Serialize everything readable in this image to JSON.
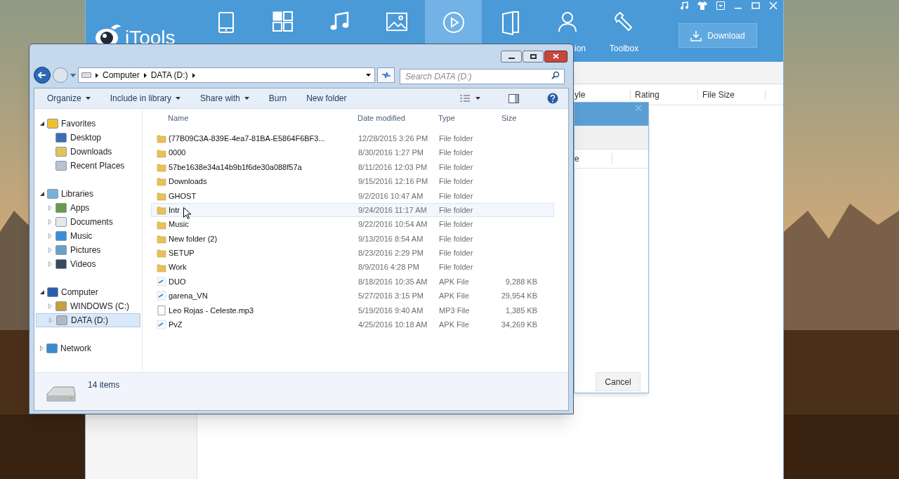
{
  "itools": {
    "logo": "iTools",
    "nav": [
      {
        "selected": false
      },
      {
        "selected": false
      },
      {
        "selected": false
      },
      {
        "selected": false
      },
      {
        "selected": true
      },
      {
        "selected": false
      },
      {
        "selected": false,
        "label": "ion"
      },
      {
        "selected": false,
        "label": "Toolbox"
      }
    ],
    "download_button": "Download",
    "columns": [
      "yle",
      "Rating",
      "File Size"
    ],
    "dialog": {
      "column": "e",
      "cancel": "Cancel"
    }
  },
  "explorer": {
    "breadcrumbs": [
      "Computer",
      "DATA (D:)"
    ],
    "search": {
      "placeholder": "Search DATA (D:)"
    },
    "toolbar": [
      {
        "label": "Organize",
        "dropdown": true
      },
      {
        "label": "Include in library",
        "dropdown": true
      },
      {
        "label": "Share with",
        "dropdown": true
      },
      {
        "label": "Burn",
        "dropdown": false
      },
      {
        "label": "New folder",
        "dropdown": false
      }
    ],
    "nav": [
      {
        "label": "Favorites",
        "expanded": true,
        "selected": false,
        "children": [
          {
            "label": "Desktop",
            "arrow": false,
            "selected": false
          },
          {
            "label": "Downloads",
            "arrow": false,
            "selected": false
          },
          {
            "label": "Recent Places",
            "arrow": false,
            "selected": false
          }
        ]
      },
      {
        "label": "Libraries",
        "expanded": true,
        "selected": false,
        "children": [
          {
            "label": "Apps",
            "arrow": true,
            "selected": false
          },
          {
            "label": "Documents",
            "arrow": true,
            "selected": false
          },
          {
            "label": "Music",
            "arrow": true,
            "selected": false
          },
          {
            "label": "Pictures",
            "arrow": true,
            "selected": false
          },
          {
            "label": "Videos",
            "arrow": true,
            "selected": false
          }
        ]
      },
      {
        "label": "Computer",
        "expanded": true,
        "selected": false,
        "children": [
          {
            "label": "WINDOWS (C:)",
            "arrow": true,
            "selected": false
          },
          {
            "label": "DATA (D:)",
            "arrow": true,
            "selected": true
          }
        ]
      },
      {
        "label": "Network",
        "expanded": false,
        "selected": false
      }
    ],
    "columns": [
      "Name",
      "Date modified",
      "Type",
      "Size"
    ],
    "files": [
      {
        "name": "{77B09C3A-839E-4ea7-81BA-E5864F6BF3...",
        "date": "12/28/2015 3:26 PM",
        "type": "File folder",
        "kind": "folder",
        "hovered": false
      },
      {
        "name": "0000",
        "date": "8/30/2016 1:27 PM",
        "type": "File folder",
        "kind": "folder",
        "hovered": false
      },
      {
        "name": "57be1638e34a14b9b1f6de30a088f57a",
        "date": "8/11/2016 12:03 PM",
        "type": "File folder",
        "kind": "folder",
        "hovered": false
      },
      {
        "name": "Downloads",
        "date": "9/15/2016 12:16 PM",
        "type": "File folder",
        "kind": "folder",
        "hovered": false
      },
      {
        "name": "GHOST",
        "date": "9/2/2016 10:47 AM",
        "type": "File folder",
        "kind": "folder",
        "hovered": false
      },
      {
        "name": "Intr",
        "date": "9/24/2016 11:17 AM",
        "type": "File folder",
        "kind": "folder",
        "hovered": true
      },
      {
        "name": "Music",
        "date": "9/22/2016 10:54 AM",
        "type": "File folder",
        "kind": "folder",
        "hovered": false
      },
      {
        "name": "New folder (2)",
        "date": "9/13/2016 8:54 AM",
        "type": "File folder",
        "kind": "folder",
        "hovered": false
      },
      {
        "name": "SETUP",
        "date": "8/23/2016 2:29 PM",
        "type": "File folder",
        "kind": "folder",
        "hovered": false
      },
      {
        "name": "Work",
        "date": "8/9/2016 4:28 PM",
        "type": "File folder",
        "kind": "folder",
        "hovered": false
      },
      {
        "name": "DUO",
        "date": "8/18/2016 10:35 AM",
        "type": "APK File",
        "size": "9,288 KB",
        "kind": "apk",
        "hovered": false
      },
      {
        "name": "garena_VN",
        "date": "5/27/2016 3:15 PM",
        "type": "APK File",
        "size": "29,954 KB",
        "kind": "apk",
        "hovered": false
      },
      {
        "name": "Leo Rojas - Celeste.mp3",
        "date": "5/19/2016 9:40 AM",
        "type": "MP3 File",
        "size": "1,385 KB",
        "kind": "file",
        "hovered": false
      },
      {
        "name": "PvZ",
        "date": "4/25/2016 10:18 AM",
        "type": "APK File",
        "size": "34,269 KB",
        "kind": "apk",
        "hovered": false
      }
    ],
    "status": "14 items"
  }
}
